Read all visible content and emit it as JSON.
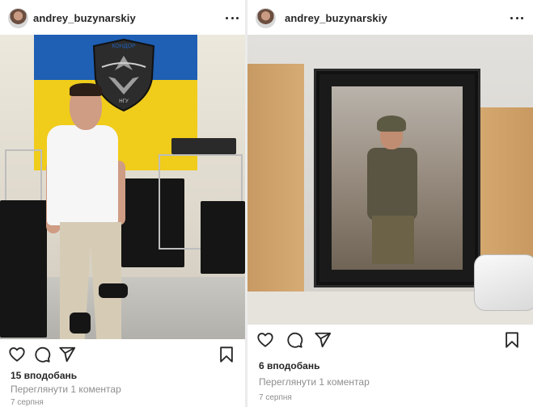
{
  "posts": [
    {
      "username": "andrey_buzynarskiy",
      "likes": "15 вподобань",
      "comments_link": "Переглянути 1 коментар",
      "date": "7 серпня",
      "flag_text": "КОНДОР",
      "emblem_text": "НГУ"
    },
    {
      "username": "andrey_buzynarskiy",
      "likes": "6 вподобань",
      "comments_link": "Переглянути 1 коментар",
      "date": "7 серпня"
    }
  ],
  "icons": {
    "like": "heart-icon",
    "comment": "comment-icon",
    "share": "send-icon",
    "save": "bookmark-icon",
    "more": "more-icon"
  },
  "colors": {
    "text": "#262626",
    "secondary": "#8e8e8e",
    "flag_blue": "#1f5fb4",
    "flag_yellow": "#f0cc1b"
  }
}
